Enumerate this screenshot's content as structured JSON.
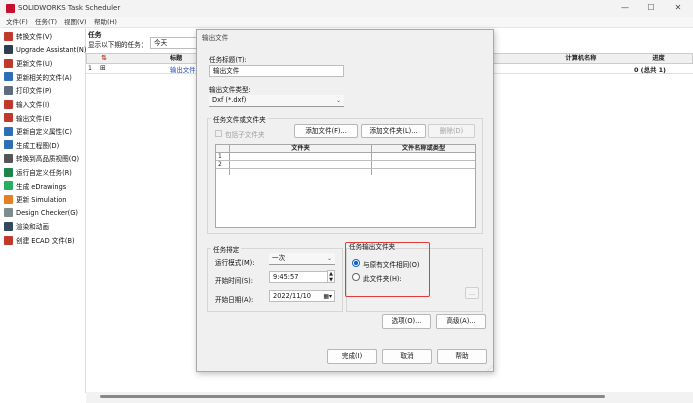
{
  "app": {
    "title": "SOLIDWORKS Task Scheduler"
  },
  "window_controls": {
    "minimize": "—",
    "maximize": "☐",
    "close": "✕"
  },
  "menu": [
    {
      "label": "文件(F)"
    },
    {
      "label": "任务(T)"
    },
    {
      "label": "视图(V)"
    },
    {
      "label": "帮助(H)"
    }
  ],
  "sidebar": {
    "items": [
      {
        "label": "转换文件(V)",
        "icon": "convert-files-icon",
        "color": "#c0392b"
      },
      {
        "label": "Upgrade Assistant(N)",
        "icon": "upgrade-icon",
        "color": "#2c3e50"
      },
      {
        "label": "更新文件(U)",
        "icon": "update-files-icon",
        "color": "#c0392b"
      },
      {
        "label": "更新相关的文件(A)",
        "icon": "update-related-icon",
        "color": "#2c6fb7"
      },
      {
        "label": "打印文件(P)",
        "icon": "print-icon",
        "color": "#5d6d7e"
      },
      {
        "label": "输入文件(I)",
        "icon": "import-icon",
        "color": "#c0392b"
      },
      {
        "label": "输出文件(E)",
        "icon": "export-icon",
        "color": "#c0392b"
      },
      {
        "label": "更新自定义属性(C)",
        "icon": "custom-properties-icon",
        "color": "#2c6fb7"
      },
      {
        "label": "生成工程图(D)",
        "icon": "drawing-icon",
        "color": "#2c6fb7"
      },
      {
        "label": "转换到高品质视图(Q)",
        "icon": "hq-view-icon",
        "color": "#555555"
      },
      {
        "label": "运行自定义任务(R)",
        "icon": "custom-task-icon",
        "color": "#1e8449"
      },
      {
        "label": "生成 eDrawings",
        "icon": "edrawings-icon",
        "color": "#27ae60"
      },
      {
        "label": "更新 Simulation",
        "icon": "simulation-icon",
        "color": "#e67e22"
      },
      {
        "label": "Design Checker(G)",
        "icon": "design-checker-icon",
        "color": "#7f8c8d"
      },
      {
        "label": "渲染和动画",
        "icon": "render-icon",
        "color": "#34495e"
      },
      {
        "label": "创建 ECAD 文件(B)",
        "icon": "ecad-icon",
        "color": "#c0392b"
      }
    ]
  },
  "main": {
    "section_title": "任务",
    "filter_label": "显示以下期的任务：",
    "filter_value": "今天",
    "columns": {
      "sort_icon": "sort-icon",
      "title": "标题",
      "computer": "计算机名称",
      "progress": "进度"
    },
    "rows": [
      {
        "num": "1",
        "expand": "⊞",
        "title": "输出文件",
        "computer": "",
        "progress": "0 (总共 1)"
      }
    ]
  },
  "dialog": {
    "title": "输出文件",
    "task_title_label": "任务标题(T):",
    "task_title_value": "输出文件",
    "output_type_label": "输出文件类型:",
    "output_type_value": "Dxf (*.dxf)",
    "files_group_label": "任务文件或文件夹",
    "include_subfolders_label": "包括子文件夹",
    "add_file_button": "添加文件(F)...",
    "add_folder_button": "添加文件夹(L)...",
    "delete_button": "删除(D)",
    "table": {
      "col_folder": "文件夹",
      "col_name_type": "文件名称或类型",
      "rows": [
        {
          "num": "1"
        },
        {
          "num": "2"
        }
      ]
    },
    "schedule_group_label": "任务排定",
    "run_mode_label": "运行模式(M):",
    "run_mode_value": "一次",
    "start_time_label": "开始时间(S):",
    "start_time_value": "9:45:57",
    "start_date_label": "开始日期(A):",
    "start_date_value": "2022/11/10",
    "output_folder_group_label": "任务输出文件夹",
    "radio_same_label": "与原有文件相同(O)",
    "radio_this_label": "此文件夹(H):",
    "browse_button": "...",
    "options_button": "选项(O)...",
    "advanced_button": "高级(A)...",
    "finish_button": "完成(I)",
    "cancel_button": "取消",
    "help_button": "帮助",
    "accent_color": "#1565c0",
    "highlight_color": "#e53a3a"
  }
}
